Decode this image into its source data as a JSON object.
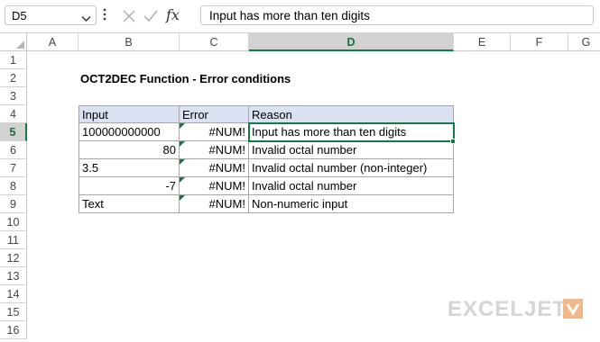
{
  "formula_bar": {
    "name_box": "D5",
    "formula": "Input has more than ten digits",
    "fx_label": "fx",
    "icons": [
      "chevron-down-icon",
      "more-vertical-icon",
      "cancel-x-icon",
      "confirm-check-icon",
      "insert-function-icon"
    ]
  },
  "columns": [
    "A",
    "B",
    "C",
    "D",
    "E",
    "F",
    "G"
  ],
  "rows": [
    "1",
    "2",
    "3",
    "4",
    "5",
    "6",
    "7",
    "8",
    "9",
    "10",
    "11",
    "12",
    "13",
    "14",
    "15",
    "16"
  ],
  "selected_column": "D",
  "selected_row": "5",
  "sheet": {
    "title": "OCT2DEC Function - Error conditions",
    "headers": {
      "input": "Input",
      "error": "Error",
      "reason": "Reason"
    },
    "table": [
      {
        "input": "100000000000",
        "error": "#NUM!",
        "reason": "Input has more than ten digits"
      },
      {
        "input": "80",
        "error": "#NUM!",
        "reason": "Invalid octal number"
      },
      {
        "input": "3.5",
        "error": "#NUM!",
        "reason": "Invalid octal number (non-integer)"
      },
      {
        "input": "-7",
        "error": "#NUM!",
        "reason": "Invalid octal number"
      },
      {
        "input": "Text",
        "error": "#NUM!",
        "reason": "Non-numeric input"
      }
    ]
  },
  "brand": {
    "name": "EXCELJET",
    "logo_color": "#f2b78b"
  },
  "colors": {
    "accent": "#107c41",
    "header_fill": "#d9e1f2",
    "error_flag": "#127a3c"
  }
}
